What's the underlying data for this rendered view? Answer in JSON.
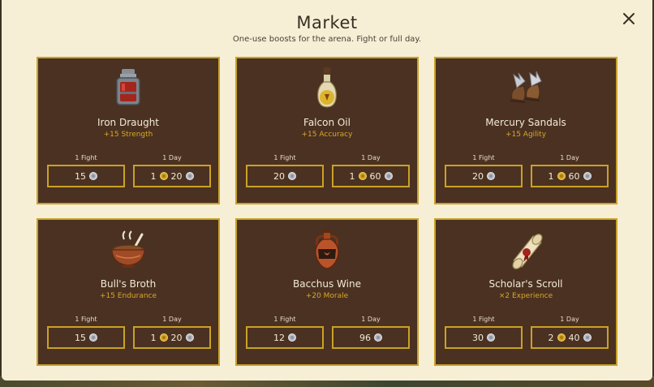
{
  "market": {
    "title": "Market",
    "subtitle": "One-use boosts for the arena. Fight or full day.",
    "labels": {
      "fight": "1 Fight",
      "day": "1 Day"
    },
    "items": [
      {
        "name": "Iron Draught",
        "bonus": "+15 Strength",
        "icon": "potion-jar-icon",
        "fight": {
          "silver": "15"
        },
        "day": {
          "gold": "1",
          "silver": "20"
        }
      },
      {
        "name": "Falcon Oil",
        "bonus": "+15 Accuracy",
        "icon": "oil-bottle-icon",
        "fight": {
          "silver": "20"
        },
        "day": {
          "gold": "1",
          "silver": "60"
        }
      },
      {
        "name": "Mercury Sandals",
        "bonus": "+15 Agility",
        "icon": "winged-sandals-icon",
        "fight": {
          "silver": "20"
        },
        "day": {
          "gold": "1",
          "silver": "60"
        }
      },
      {
        "name": "Bull's Broth",
        "bonus": "+15 Endurance",
        "icon": "broth-bowl-icon",
        "fight": {
          "silver": "15"
        },
        "day": {
          "gold": "1",
          "silver": "20"
        }
      },
      {
        "name": "Bacchus Wine",
        "bonus": "+20 Morale",
        "icon": "wine-amphora-icon",
        "fight": {
          "silver": "12"
        },
        "day": {
          "silver": "96"
        }
      },
      {
        "name": "Scholar's Scroll",
        "bonus": "×2 Experience",
        "icon": "scroll-icon",
        "fight": {
          "silver": "30"
        },
        "day": {
          "gold": "2",
          "silver": "40"
        }
      }
    ]
  },
  "colors": {
    "panel": "#f6efd6",
    "card": "#4b3121",
    "border": "#c9a227",
    "bonus": "#d4a92c",
    "gold_coin": "#d9a520",
    "silver_coin": "#b8bcc6"
  }
}
